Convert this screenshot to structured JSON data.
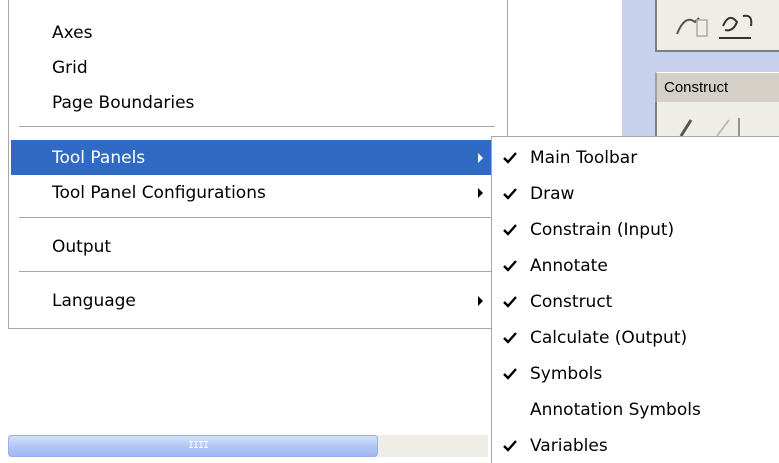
{
  "menu": {
    "items": [
      {
        "label": "Axes",
        "submenu": false,
        "highlighted": false
      },
      {
        "label": "Grid",
        "submenu": false,
        "highlighted": false
      },
      {
        "label": "Page Boundaries",
        "submenu": false,
        "highlighted": false
      },
      {
        "label": "Tool Panels",
        "submenu": true,
        "highlighted": true
      },
      {
        "label": "Tool Panel Configurations",
        "submenu": true,
        "highlighted": false
      },
      {
        "label": "Output",
        "submenu": false,
        "highlighted": false
      },
      {
        "label": "Language",
        "submenu": true,
        "highlighted": false
      }
    ],
    "highlight_color": "#316ac5"
  },
  "submenu": {
    "items": [
      {
        "label": "Main Toolbar",
        "checked": true
      },
      {
        "label": "Draw",
        "checked": true
      },
      {
        "label": "Constrain (Input)",
        "checked": true
      },
      {
        "label": "Annotate",
        "checked": true
      },
      {
        "label": "Construct",
        "checked": true
      },
      {
        "label": "Calculate (Output)",
        "checked": true
      },
      {
        "label": "Symbols",
        "checked": true
      },
      {
        "label": "Annotation Symbols",
        "checked": false
      },
      {
        "label": "Variables",
        "checked": true
      }
    ]
  },
  "background": {
    "panel_header": "Construct",
    "scrollbar_grip_icon": "grip-lines-icon",
    "panel_bg_color": "#c7d1ec"
  }
}
